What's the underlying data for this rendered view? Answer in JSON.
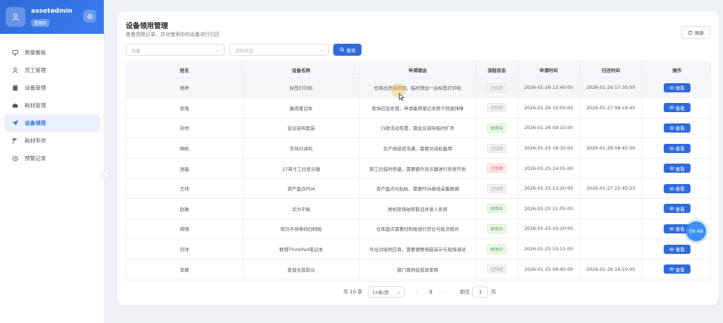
{
  "user": {
    "name": "assetadmin",
    "role": "管理员"
  },
  "menu": [
    {
      "label": "数据看板",
      "icon": "monitor-icon"
    },
    {
      "label": "员工管理",
      "icon": "user-icon"
    },
    {
      "label": "设备管理",
      "icon": "clipboard-icon"
    },
    {
      "label": "耗材管理",
      "icon": "box-icon"
    },
    {
      "label": "设备领用",
      "icon": "send-icon",
      "active": true
    },
    {
      "label": "耗材申领",
      "icon": "flag-icon"
    },
    {
      "label": "预警记录",
      "icon": "alarm-icon"
    }
  ],
  "page": {
    "title": "设备领用管理",
    "subtitle": "查看领用记录，并对使用中的设备进行归还",
    "refresh_label": "刷新",
    "device_placeholder": "设备",
    "status_placeholder": "流程状态",
    "search_label": "查询"
  },
  "table": {
    "headers": [
      "姓名",
      "设备名称",
      "申请理由",
      "流程状态",
      "申请时间",
      "归还时间",
      "操作"
    ],
    "action_label": "查看",
    "rows": [
      {
        "name": "吴婷",
        "device": "标签打印机",
        "reason": "仓库出货高峰期，临时增加一台标签打印机",
        "status": "已归还",
        "status_type": "returned",
        "apply_time": "2026-01-26 13:40:00",
        "return_time": "2026-01-26 17:30:00"
      },
      {
        "name": "徐强",
        "device": "备用笔记本",
        "reason": "现场应急处理，申请备用笔记本用于快速排障",
        "status": "已归还",
        "status_type": "returned",
        "apply_time": "2026-01-26 10:05:00",
        "return_time": "2026-01-27 08:19:45"
      },
      {
        "name": "孙悦",
        "device": "会议音响套装",
        "reason": "行政活动布置，需会议音响临时扩声",
        "status": "使用中",
        "status_type": "inuse",
        "apply_time": "2026-01-26 09:10:00",
        "return_time": ""
      },
      {
        "name": "杨帆",
        "device": "手持对讲机",
        "reason": "生产线巡班沟通，需要对讲机备用",
        "status": "已归还",
        "status_type": "returned",
        "apply_time": "2026-01-25 18:30:00",
        "return_time": "2026-01-26 08:45:00"
      },
      {
        "name": "张磊",
        "device": "27英寸工位显示器",
        "reason": "新工位临时搭建，需要额外显示器进行多屏开发",
        "status": "已拒绝",
        "status_type": "rejected",
        "apply_time": "2026-01-25 14:05:00",
        "return_time": ""
      },
      {
        "name": "王伟",
        "device": "资产盘点PDA",
        "reason": "资产盘点与贴标，需要PDA离线采集数据",
        "status": "已归还",
        "status_type": "returned",
        "apply_time": "2026-01-25 13:20:00",
        "return_time": "2026-01-27 22:45:23"
      },
      {
        "name": "赵敏",
        "device": "华为平板",
        "reason": "质检现场拍照取证并录入系统",
        "status": "使用中",
        "status_type": "inuse",
        "apply_time": "2026-01-25 11:05:00",
        "return_time": ""
      },
      {
        "name": "周强",
        "device": "斑马手持条码扫码枪",
        "reason": "仓库盘点需要扫码枪进行货位与批次核对",
        "status": "使用中",
        "status_type": "inuse",
        "apply_time": "2026-01-25 10:20:00",
        "return_time": ""
      },
      {
        "name": "刘洋",
        "device": "联想ThinkPad笔记本",
        "reason": "外出对接供应商，需要便携电脑演示与现场调试",
        "status": "使用中",
        "status_type": "inuse",
        "apply_time": "2026-01-25 10:15:00",
        "return_time": ""
      },
      {
        "name": "李娜",
        "device": "爱普生投影仪",
        "reason": "部门周例会投屏使用",
        "status": "已归还",
        "status_type": "returned",
        "apply_time": "2026-01-25 09:40:00",
        "return_time": "2026-01-26 16:10:00"
      }
    ]
  },
  "pagination": {
    "total": "共 10 条",
    "page_size": "10条/页",
    "current": "1",
    "goto_label": "前往",
    "goto_value": "1",
    "page_suffix": "页"
  },
  "float_time": "06:48",
  "colors": {
    "primary": "#2f6bd9",
    "success": "#49a64b",
    "danger": "#e24c4c",
    "muted": "#909399"
  }
}
